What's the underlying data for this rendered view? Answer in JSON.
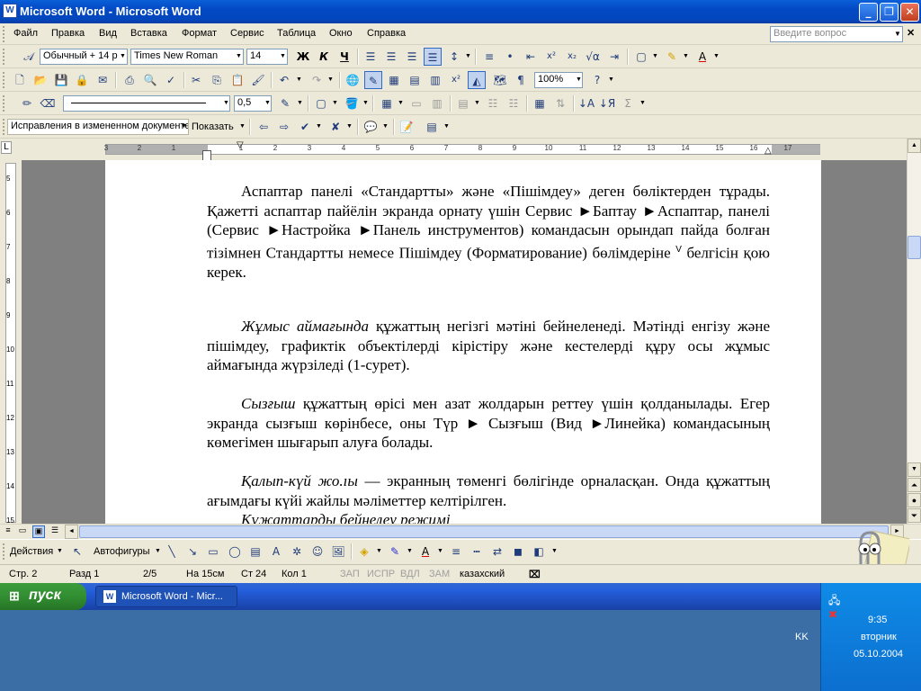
{
  "window": {
    "title": "Microsoft Word - Microsoft Word",
    "app_icon": "W"
  },
  "menubar": {
    "items": [
      "Файл",
      "Правка",
      "Вид",
      "Вставка",
      "Формат",
      "Сервис",
      "Таблица",
      "Окно",
      "Справка"
    ],
    "help_placeholder": "Введите вопрос"
  },
  "format_toolbar": {
    "style": "Обычный + 14 р",
    "font": "Times New Roman",
    "size": "14",
    "bold": "Ж",
    "italic": "К",
    "underline": "Ч"
  },
  "standard_toolbar": {
    "zoom": "100%"
  },
  "drawing_table_toolbar": {
    "line_weight": "0,5"
  },
  "review_toolbar": {
    "mode": "Исправления в измененном документе",
    "show": "Показать"
  },
  "ruler": {
    "labels": [
      "3",
      "2",
      "1",
      "1",
      "2",
      "3",
      "4",
      "5",
      "6",
      "7",
      "8",
      "9",
      "10",
      "11",
      "12",
      "13",
      "14",
      "15",
      "16",
      "17"
    ],
    "vlabels": [
      "5",
      "6",
      "7",
      "8",
      "9",
      "10",
      "11",
      "12",
      "13",
      "14",
      "15"
    ]
  },
  "document": {
    "p1": "Аспаптар панелі «Стандартты» және «Пішімдеу» деген бөліктерден тұрады. Қажетті аспаптар пайёлін экранда орнату үшін Сервис ►Баптау ►Аспаптар, панелі (Сервис ►Настройка ►Панель инструментов) командасын орындап пайда болған тізімнен Стандартты немесе Пішімдеу (Форматирование) бөлімдеріне ",
    "p1_check": "V",
    "p1_end": " белгісін қою керек.",
    "p2_italic": "Жұмыс аймағында",
    "p2": " құжаттың негізгі мәтіні бейнеленеді. Мәтінді енгізу және пішімдеу, графиктік объектілерді кірістіру және кестелерді құру осы жұмыс аймағында жүрзіледі (1-сурет).",
    "p3_italic": "Сызғыш",
    "p3": " құжаттың өрісі мен азат жолдарын реттеу үшін қолданылады. Егер экранда сызғыш көрінбесе, оны Түр ► Сызғыш (Вид ►Линейка) командасының көмегімен шығарып алуға болады.",
    "p4_italic": "Қалып-күй жо.ıы",
    "p4": " — экранның төменгі бөлігінде орналасқан. Онда құжаттың ағымдағы күйі жайлы мәліметтер келтірілген.",
    "p5_italic": "Құжаттарды бейнелеу режимі"
  },
  "drawing_toolbar": {
    "actions": "Действия",
    "autoshapes": "Автофигуры"
  },
  "statusbar": {
    "page": "Стр. 2",
    "section": "Разд 1",
    "pages": "2/5",
    "at": "На 15см",
    "line": "Ст 24",
    "col": "Кол 1",
    "rec": "ЗАП",
    "trk": "ИСПР",
    "ext": "ВДЛ",
    "ovr": "ЗАМ",
    "language": "казахский"
  },
  "taskbar": {
    "start": "пуск",
    "task": "Microsoft Word - Micr...",
    "lang": "KK",
    "time": "9:35",
    "day": "вторник",
    "date": "05.10.2004"
  }
}
